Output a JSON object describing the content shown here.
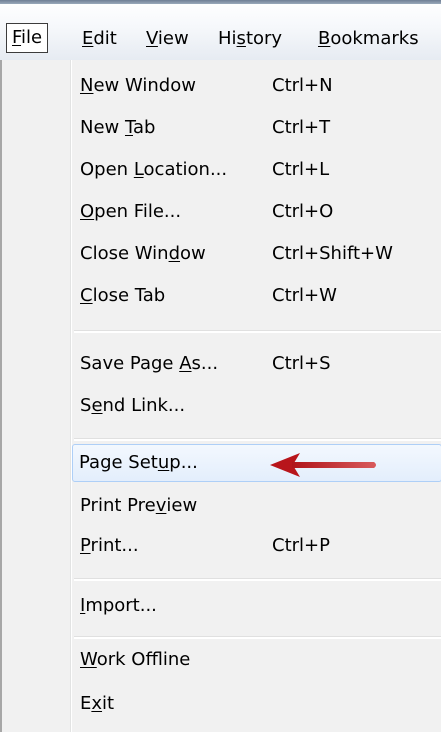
{
  "menubar": {
    "items": [
      {
        "pre": "",
        "acc": "F",
        "post": "ile"
      },
      {
        "pre": "",
        "acc": "E",
        "post": "dit"
      },
      {
        "pre": "",
        "acc": "V",
        "post": "iew"
      },
      {
        "pre": "Hi",
        "acc": "s",
        "post": "tory"
      },
      {
        "pre": "",
        "acc": "B",
        "post": "ookmarks"
      }
    ]
  },
  "file_menu": {
    "items": [
      {
        "pre": "",
        "acc": "N",
        "post": "ew Window",
        "shortcut": "Ctrl+N"
      },
      {
        "pre": "New ",
        "acc": "T",
        "post": "ab",
        "shortcut": "Ctrl+T"
      },
      {
        "pre": "Open ",
        "acc": "L",
        "post": "ocation...",
        "shortcut": "Ctrl+L"
      },
      {
        "pre": "",
        "acc": "O",
        "post": "pen File...",
        "shortcut": "Ctrl+O"
      },
      {
        "pre": "Close Win",
        "acc": "d",
        "post": "ow",
        "shortcut": "Ctrl+Shift+W"
      },
      {
        "pre": "",
        "acc": "C",
        "post": "lose Tab",
        "shortcut": "Ctrl+W"
      },
      {
        "pre": "Save Page ",
        "acc": "A",
        "post": "s...",
        "shortcut": "Ctrl+S"
      },
      {
        "pre": "S",
        "acc": "e",
        "post": "nd Link...",
        "shortcut": ""
      },
      {
        "pre": "Page Set",
        "acc": "u",
        "post": "p...",
        "shortcut": ""
      },
      {
        "pre": "Print Pre",
        "acc": "v",
        "post": "iew",
        "shortcut": ""
      },
      {
        "pre": "",
        "acc": "P",
        "post": "rint...",
        "shortcut": "Ctrl+P"
      },
      {
        "pre": "",
        "acc": "I",
        "post": "mport...",
        "shortcut": ""
      },
      {
        "pre": "",
        "acc": "W",
        "post": "ork Offline",
        "shortcut": ""
      },
      {
        "pre": "E",
        "acc": "x",
        "post": "it",
        "shortcut": ""
      }
    ]
  },
  "colors": {
    "highlight_border": "#aecff7",
    "arrow": "#c0181c"
  },
  "icons": {
    "annotation": "red-arrow-left"
  }
}
